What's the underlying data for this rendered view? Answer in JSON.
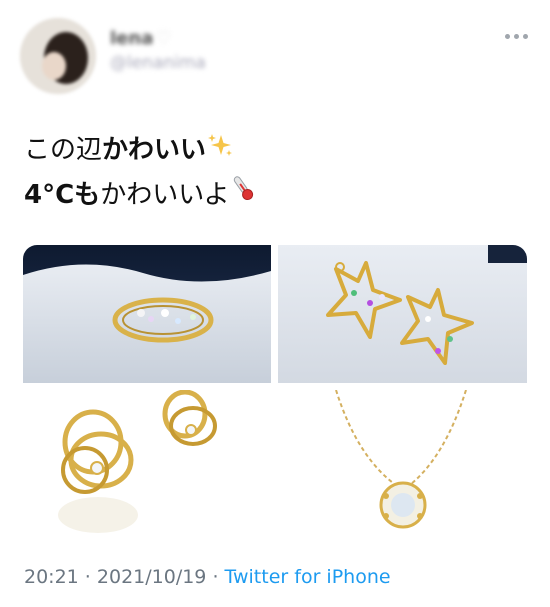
{
  "user": {
    "display_name": "lena",
    "handle": "@lenanima"
  },
  "tweet": {
    "line1_prefix": "この辺",
    "line1_bold": "かわいい",
    "line2_bold": "4°Cも",
    "line2_suffix": "かわいいよ"
  },
  "media": [
    {
      "alt": "ring"
    },
    {
      "alt": "star earrings"
    },
    {
      "alt": "loop earrings"
    },
    {
      "alt": "necklace"
    }
  ],
  "meta": {
    "time": "20:21",
    "separator": " · ",
    "date": "2021/10/19",
    "client": "Twitter for iPhone"
  },
  "icons": [
    "heart-icon",
    "sparkles-icon",
    "thermometer-icon",
    "more-icon"
  ]
}
